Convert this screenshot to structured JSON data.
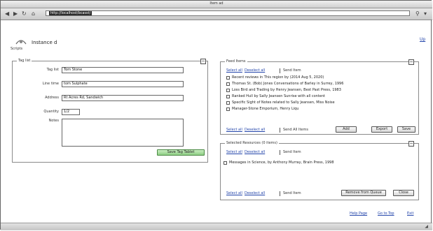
{
  "window": {
    "title": "Item ad"
  },
  "toolbar": {
    "url": "http://localhost/bcasst/"
  },
  "header": {
    "title": "Instance d",
    "logo_caption": "Scripts",
    "top_link": "Up"
  },
  "left_panel": {
    "legend": "Tag list",
    "collapse": "−",
    "fields": [
      {
        "label": "Tag list",
        "value": "Tom Stone"
      },
      {
        "label": "Line time",
        "value": "tom Sulphate"
      },
      {
        "label": "Address",
        "value": "Rt Acres Rd, Sandwich"
      },
      {
        "label": "Quantity",
        "value": "1/2"
      },
      {
        "label": "Notes",
        "value": ""
      }
    ],
    "button": "Save Tag Tablet"
  },
  "feed_panel": {
    "legend": "Feed Items",
    "collapse": "−",
    "top_links": [
      "Select all",
      "Deselect all"
    ],
    "top_plain": "Send Item",
    "items": [
      "Recent reviews in This region by (2014 Aug 5, 2020)",
      "Thomas St. (Bob) Jones Conversations of Barley in Surrey, 1996",
      "Loss Bird and Trading by Henry Jeansen, Best Past Press, 1983",
      "Ranked Hull by Sally Jeansen Sunrise with all content",
      "Specific Sight of Notes related to Sally Jeansen, Miss Noise",
      "Manager-Stone Emporium, Henry Liqu"
    ],
    "bottom_links": [
      "Select all",
      "Deselect all"
    ],
    "bottom_plain": "Send All Items",
    "buttons": [
      "Add",
      "Export",
      "Save"
    ]
  },
  "selected_panel": {
    "legend": "Selected Resources (0 items)",
    "collapse": "−",
    "top_links": [
      "Select all",
      "Deselect all"
    ],
    "top_plain": "Send Item",
    "items": [
      "Messages in Science, by Anthony Murray, Brain Press, 1998"
    ],
    "bottom_links": [
      "Select all",
      "Deselect all"
    ],
    "bottom_plain": "Send Item",
    "buttons": [
      "Remove from Queue",
      "Close"
    ]
  },
  "footer": {
    "links": [
      "Help Page",
      "Go to Top",
      "Exit"
    ]
  }
}
